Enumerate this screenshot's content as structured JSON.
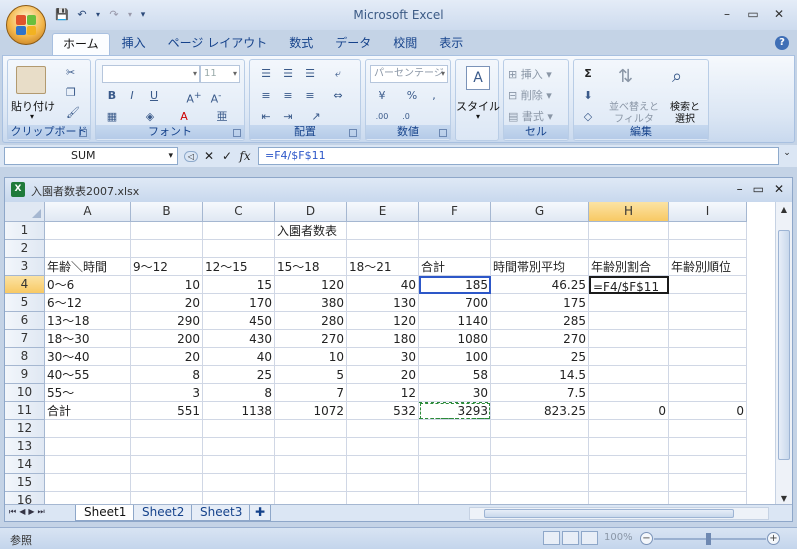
{
  "app": {
    "title": "Microsoft Excel",
    "tabs": [
      "ホーム",
      "挿入",
      "ページ レイアウト",
      "数式",
      "データ",
      "校閲",
      "表示"
    ],
    "active_tab": "ホーム"
  },
  "qat": {
    "save_icon": "save-icon",
    "undo_icon": "undo-icon",
    "redo_icon": "redo-icon"
  },
  "ribbon": {
    "clipboard": {
      "label": "クリップボード",
      "paste": "貼り付け"
    },
    "font": {
      "label": "フォント",
      "font_name": "",
      "font_size": "11"
    },
    "alignment": {
      "label": "配置"
    },
    "number": {
      "label": "数値",
      "format": "パーセンテージ"
    },
    "styles": {
      "label": "スタイル"
    },
    "cells": {
      "label": "セル",
      "insert": "挿入",
      "delete": "削除",
      "format": "書式"
    },
    "editing": {
      "label": "編集",
      "sort": "並べ替えと",
      "sort2": "フィルタ",
      "find": "検索と",
      "find2": "選択"
    }
  },
  "formula_bar": {
    "name_box": "SUM",
    "formula": "=F4/$F$11"
  },
  "workbook": {
    "title": "入園者数表2007.xlsx",
    "columns": [
      "A",
      "B",
      "C",
      "D",
      "E",
      "F",
      "G",
      "H",
      "I"
    ],
    "rows": [
      "1",
      "2",
      "3",
      "4",
      "5",
      "6",
      "7",
      "8",
      "9",
      "10",
      "11",
      "12",
      "13",
      "14",
      "15",
      "16"
    ],
    "cells": {
      "D1": "入園者数表",
      "A3": "年齢＼時間",
      "B3": "9〜12",
      "C3": "12〜15",
      "D3": "15〜18",
      "E3": "18〜21",
      "F3": "合計",
      "G3": "時間帯別平均",
      "H3": "年齢別割合",
      "I3": "年齢別順位",
      "A4": "0〜6",
      "B4": "10",
      "C4": "15",
      "D4": "120",
      "E4": "40",
      "F4": "185",
      "G4": "46.25",
      "H4": "=F4/$F$11",
      "A5": "6〜12",
      "B5": "20",
      "C5": "170",
      "D5": "380",
      "E5": "130",
      "F5": "700",
      "G5": "175",
      "A6": "13〜18",
      "B6": "290",
      "C6": "450",
      "D6": "280",
      "E6": "120",
      "F6": "1140",
      "G6": "285",
      "A7": "18〜30",
      "B7": "200",
      "C7": "430",
      "D7": "270",
      "E7": "180",
      "F7": "1080",
      "G7": "270",
      "A8": "30〜40",
      "B8": "20",
      "C8": "40",
      "D8": "10",
      "E8": "30",
      "F8": "100",
      "G8": "25",
      "A9": "40〜55",
      "B9": "8",
      "C9": "25",
      "D9": "5",
      "E9": "20",
      "F9": "58",
      "G9": "14.5",
      "A10": "55〜",
      "B10": "3",
      "C10": "8",
      "D10": "7",
      "E10": "12",
      "F10": "30",
      "G10": "7.5",
      "A11": "合計",
      "B11": "551",
      "C11": "1138",
      "D11": "1072",
      "E11": "532",
      "F11": "3293",
      "G11": "823.25",
      "H11": "0",
      "I11": "0"
    },
    "selected_cell": "H4",
    "sheets": [
      "Sheet1",
      "Sheet2",
      "Sheet3"
    ],
    "active_sheet": "Sheet1"
  },
  "status": {
    "mode": "参照",
    "zoom": "100%"
  },
  "colors": {
    "accent": "#15428b",
    "ref_blue": "#2d57c8",
    "ref_green": "#2c8a3a",
    "selected_header": "#f8c964"
  }
}
